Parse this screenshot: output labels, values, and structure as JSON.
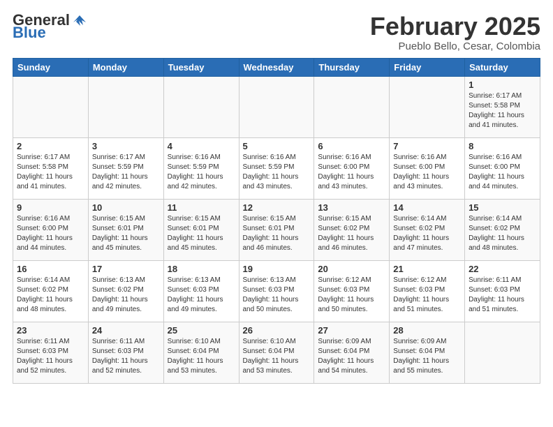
{
  "header": {
    "logo_general": "General",
    "logo_blue": "Blue",
    "month_title": "February 2025",
    "location": "Pueblo Bello, Cesar, Colombia"
  },
  "weekdays": [
    "Sunday",
    "Monday",
    "Tuesday",
    "Wednesday",
    "Thursday",
    "Friday",
    "Saturday"
  ],
  "weeks": [
    [
      {
        "day": "",
        "info": ""
      },
      {
        "day": "",
        "info": ""
      },
      {
        "day": "",
        "info": ""
      },
      {
        "day": "",
        "info": ""
      },
      {
        "day": "",
        "info": ""
      },
      {
        "day": "",
        "info": ""
      },
      {
        "day": "1",
        "info": "Sunrise: 6:17 AM\nSunset: 5:58 PM\nDaylight: 11 hours\nand 41 minutes."
      }
    ],
    [
      {
        "day": "2",
        "info": "Sunrise: 6:17 AM\nSunset: 5:58 PM\nDaylight: 11 hours\nand 41 minutes."
      },
      {
        "day": "3",
        "info": "Sunrise: 6:17 AM\nSunset: 5:59 PM\nDaylight: 11 hours\nand 42 minutes."
      },
      {
        "day": "4",
        "info": "Sunrise: 6:16 AM\nSunset: 5:59 PM\nDaylight: 11 hours\nand 42 minutes."
      },
      {
        "day": "5",
        "info": "Sunrise: 6:16 AM\nSunset: 5:59 PM\nDaylight: 11 hours\nand 43 minutes."
      },
      {
        "day": "6",
        "info": "Sunrise: 6:16 AM\nSunset: 6:00 PM\nDaylight: 11 hours\nand 43 minutes."
      },
      {
        "day": "7",
        "info": "Sunrise: 6:16 AM\nSunset: 6:00 PM\nDaylight: 11 hours\nand 43 minutes."
      },
      {
        "day": "8",
        "info": "Sunrise: 6:16 AM\nSunset: 6:00 PM\nDaylight: 11 hours\nand 44 minutes."
      }
    ],
    [
      {
        "day": "9",
        "info": "Sunrise: 6:16 AM\nSunset: 6:00 PM\nDaylight: 11 hours\nand 44 minutes."
      },
      {
        "day": "10",
        "info": "Sunrise: 6:15 AM\nSunset: 6:01 PM\nDaylight: 11 hours\nand 45 minutes."
      },
      {
        "day": "11",
        "info": "Sunrise: 6:15 AM\nSunset: 6:01 PM\nDaylight: 11 hours\nand 45 minutes."
      },
      {
        "day": "12",
        "info": "Sunrise: 6:15 AM\nSunset: 6:01 PM\nDaylight: 11 hours\nand 46 minutes."
      },
      {
        "day": "13",
        "info": "Sunrise: 6:15 AM\nSunset: 6:02 PM\nDaylight: 11 hours\nand 46 minutes."
      },
      {
        "day": "14",
        "info": "Sunrise: 6:14 AM\nSunset: 6:02 PM\nDaylight: 11 hours\nand 47 minutes."
      },
      {
        "day": "15",
        "info": "Sunrise: 6:14 AM\nSunset: 6:02 PM\nDaylight: 11 hours\nand 48 minutes."
      }
    ],
    [
      {
        "day": "16",
        "info": "Sunrise: 6:14 AM\nSunset: 6:02 PM\nDaylight: 11 hours\nand 48 minutes."
      },
      {
        "day": "17",
        "info": "Sunrise: 6:13 AM\nSunset: 6:02 PM\nDaylight: 11 hours\nand 49 minutes."
      },
      {
        "day": "18",
        "info": "Sunrise: 6:13 AM\nSunset: 6:03 PM\nDaylight: 11 hours\nand 49 minutes."
      },
      {
        "day": "19",
        "info": "Sunrise: 6:13 AM\nSunset: 6:03 PM\nDaylight: 11 hours\nand 50 minutes."
      },
      {
        "day": "20",
        "info": "Sunrise: 6:12 AM\nSunset: 6:03 PM\nDaylight: 11 hours\nand 50 minutes."
      },
      {
        "day": "21",
        "info": "Sunrise: 6:12 AM\nSunset: 6:03 PM\nDaylight: 11 hours\nand 51 minutes."
      },
      {
        "day": "22",
        "info": "Sunrise: 6:11 AM\nSunset: 6:03 PM\nDaylight: 11 hours\nand 51 minutes."
      }
    ],
    [
      {
        "day": "23",
        "info": "Sunrise: 6:11 AM\nSunset: 6:03 PM\nDaylight: 11 hours\nand 52 minutes."
      },
      {
        "day": "24",
        "info": "Sunrise: 6:11 AM\nSunset: 6:03 PM\nDaylight: 11 hours\nand 52 minutes."
      },
      {
        "day": "25",
        "info": "Sunrise: 6:10 AM\nSunset: 6:04 PM\nDaylight: 11 hours\nand 53 minutes."
      },
      {
        "day": "26",
        "info": "Sunrise: 6:10 AM\nSunset: 6:04 PM\nDaylight: 11 hours\nand 53 minutes."
      },
      {
        "day": "27",
        "info": "Sunrise: 6:09 AM\nSunset: 6:04 PM\nDaylight: 11 hours\nand 54 minutes."
      },
      {
        "day": "28",
        "info": "Sunrise: 6:09 AM\nSunset: 6:04 PM\nDaylight: 11 hours\nand 55 minutes."
      },
      {
        "day": "",
        "info": ""
      }
    ]
  ]
}
